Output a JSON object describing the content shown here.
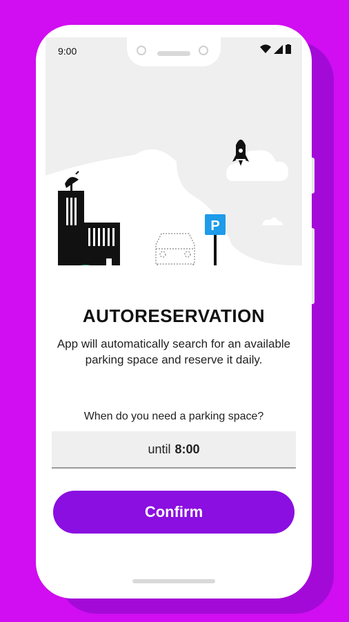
{
  "status_bar": {
    "time": "9:00"
  },
  "hero": {
    "parking_sign": "P"
  },
  "content": {
    "title": "AUTORESERVATION",
    "description": "App will automatically search for an available parking space and reserve it daily.",
    "question": "When do you need a parking space?",
    "time_field": {
      "prefix": "until",
      "value": "8:00"
    },
    "confirm_label": "Confirm"
  },
  "colors": {
    "background": "#d10df2",
    "accent": "#8a0fe0",
    "sign": "#1e9be9"
  }
}
